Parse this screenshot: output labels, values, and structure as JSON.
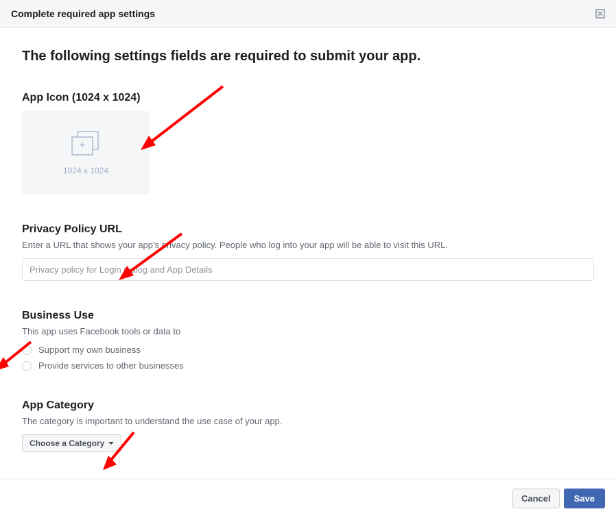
{
  "header": {
    "title": "Complete required app settings"
  },
  "main": {
    "heading": "The following settings fields are required to submit your app."
  },
  "appIcon": {
    "title": "App Icon (1024 x 1024)",
    "dims": "1024 x 1024"
  },
  "privacy": {
    "title": "Privacy Policy URL",
    "desc": "Enter a URL that shows your app's privacy policy. People who log into your app will be able to visit this URL.",
    "placeholder": "Privacy policy for Login dialog and App Details"
  },
  "business": {
    "title": "Business Use",
    "desc": "This app uses Facebook tools or data to",
    "options": [
      "Support my own business",
      "Provide services to other businesses"
    ]
  },
  "category": {
    "title": "App Category",
    "desc": "The category is important to understand the use case of your app.",
    "dropdown": "Choose a Category"
  },
  "footer": {
    "cancel": "Cancel",
    "save": "Save"
  }
}
